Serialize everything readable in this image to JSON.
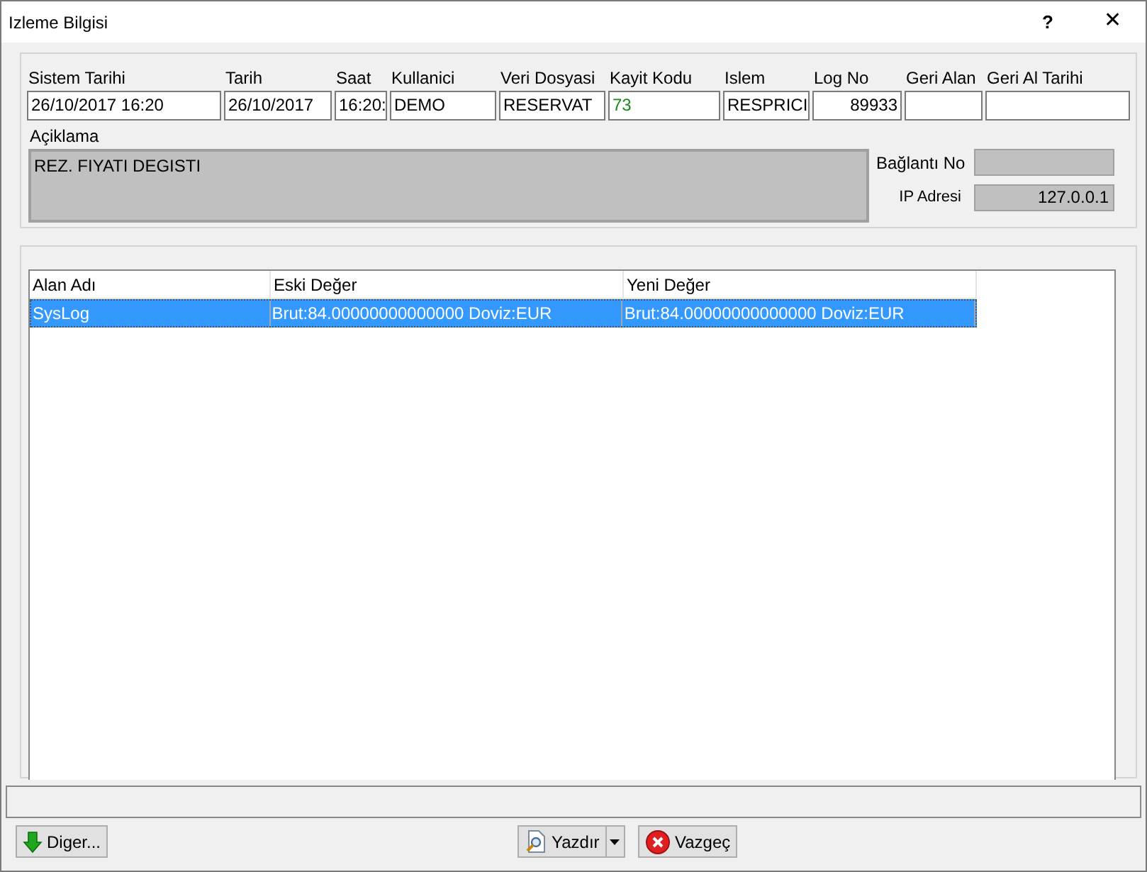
{
  "window": {
    "title": "Izleme Bilgisi",
    "help": "?",
    "close": "✕"
  },
  "fields": [
    {
      "label": "Sistem Tarihi",
      "value": "26/10/2017 16:20",
      "kind": "text"
    },
    {
      "label": "Tarih",
      "value": "26/10/2017",
      "kind": "text"
    },
    {
      "label": "Saat",
      "value": "16:20:",
      "kind": "text"
    },
    {
      "label": "Kullanici",
      "value": "DEMO",
      "kind": "text"
    },
    {
      "label": "Veri Dosyasi",
      "value": "RESERVAT",
      "kind": "text"
    },
    {
      "label": "Kayit Kodu",
      "value": "73",
      "kind": "text",
      "color": "#1a8a1a"
    },
    {
      "label": "Islem",
      "value": "RESPRICI",
      "kind": "text"
    },
    {
      "label": "Log No",
      "value": "89933",
      "kind": "number"
    },
    {
      "label": "Geri Alan",
      "kind": "text"
    },
    {
      "label": "Geri Al Tarihi",
      "kind": "text"
    }
  ],
  "description": {
    "label": "Açiklama",
    "value": "REZ. FIYATI DEGISTI"
  },
  "connection": {
    "label": "Bağlantı No"
  },
  "ip": {
    "label": "IP Adresi",
    "value": "127.0.0.1"
  },
  "table": {
    "columns": [
      "Alan Adı",
      "Eski Değer",
      "Yeni Değer"
    ],
    "rows": [
      {
        "cells": [
          "SysLog",
          "Brut:84.00000000000000 Doviz:EUR",
          "Brut:84.00000000000000 Doviz:EUR"
        ],
        "selected": true
      }
    ]
  },
  "buttons": [
    {
      "label": "Diger...",
      "kind": "other"
    },
    {
      "label": "Yazdır",
      "kind": "print"
    },
    {
      "label": "Vazgeç",
      "kind": "cancel"
    }
  ]
}
